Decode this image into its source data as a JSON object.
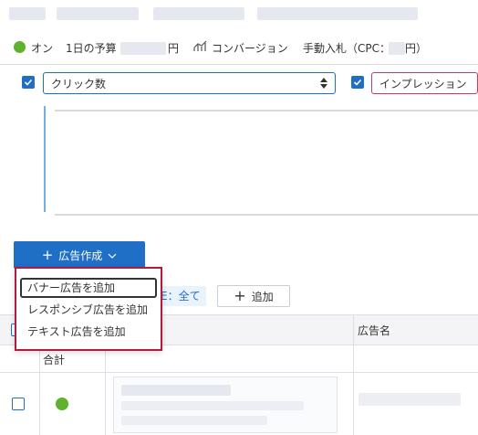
{
  "status": {
    "on_label": "オン",
    "budget_label": "1日の予算",
    "budget_unit": "円",
    "conversion_label": "コンバージョン",
    "bid_label": "手動入札（CPC：",
    "bid_unit": "円）"
  },
  "chart_controls": {
    "metric1": "クリック数",
    "metric2": "インプレッション"
  },
  "ad_create": {
    "label": "広告作成"
  },
  "dropdown": {
    "items": [
      "バナー広告を追加",
      "レスポンシブ広告を追加",
      "テキスト広告を追加"
    ]
  },
  "toolbar": {
    "filter_suffix": "E：全て",
    "add_label": "追加"
  },
  "table": {
    "col_ad_name": "広告名",
    "total_label": "合計"
  },
  "colors": {
    "accent": "#1f6fc7",
    "status_green": "#5fb22d",
    "highlight_red": "#b31b3c"
  }
}
